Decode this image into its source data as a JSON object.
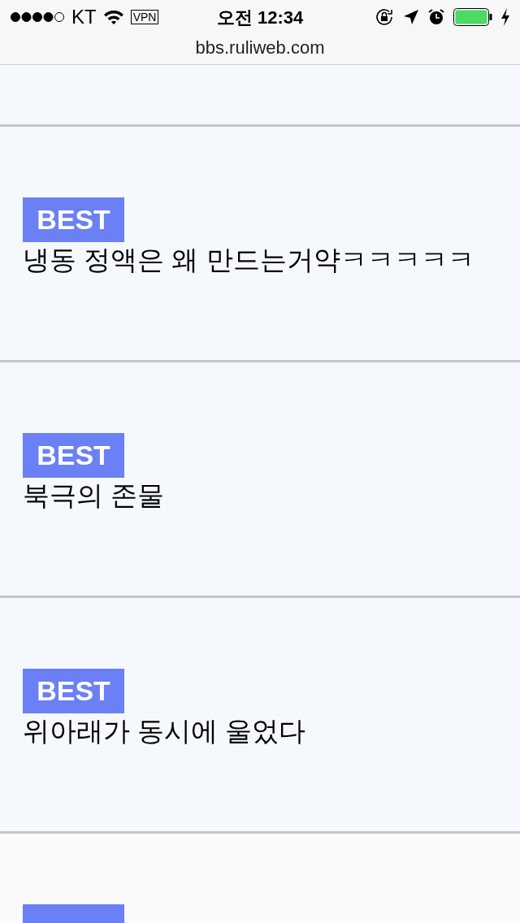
{
  "status_bar": {
    "carrier": "KT",
    "vpn": "VPN",
    "time": "오전 12:34",
    "url": "bbs.ruliweb.com"
  },
  "posts": [
    {
      "kind": "post",
      "badge": "BEST",
      "title": "냉동 정액은 왜 만드는거약ㅋㅋㅋㅋㅋ"
    },
    {
      "kind": "post",
      "badge": "BEST",
      "title": "북극의 존물"
    },
    {
      "kind": "post",
      "badge": "BEST",
      "title": "위아래가 동시에 울었다"
    },
    {
      "kind": "cut_off"
    }
  ]
}
